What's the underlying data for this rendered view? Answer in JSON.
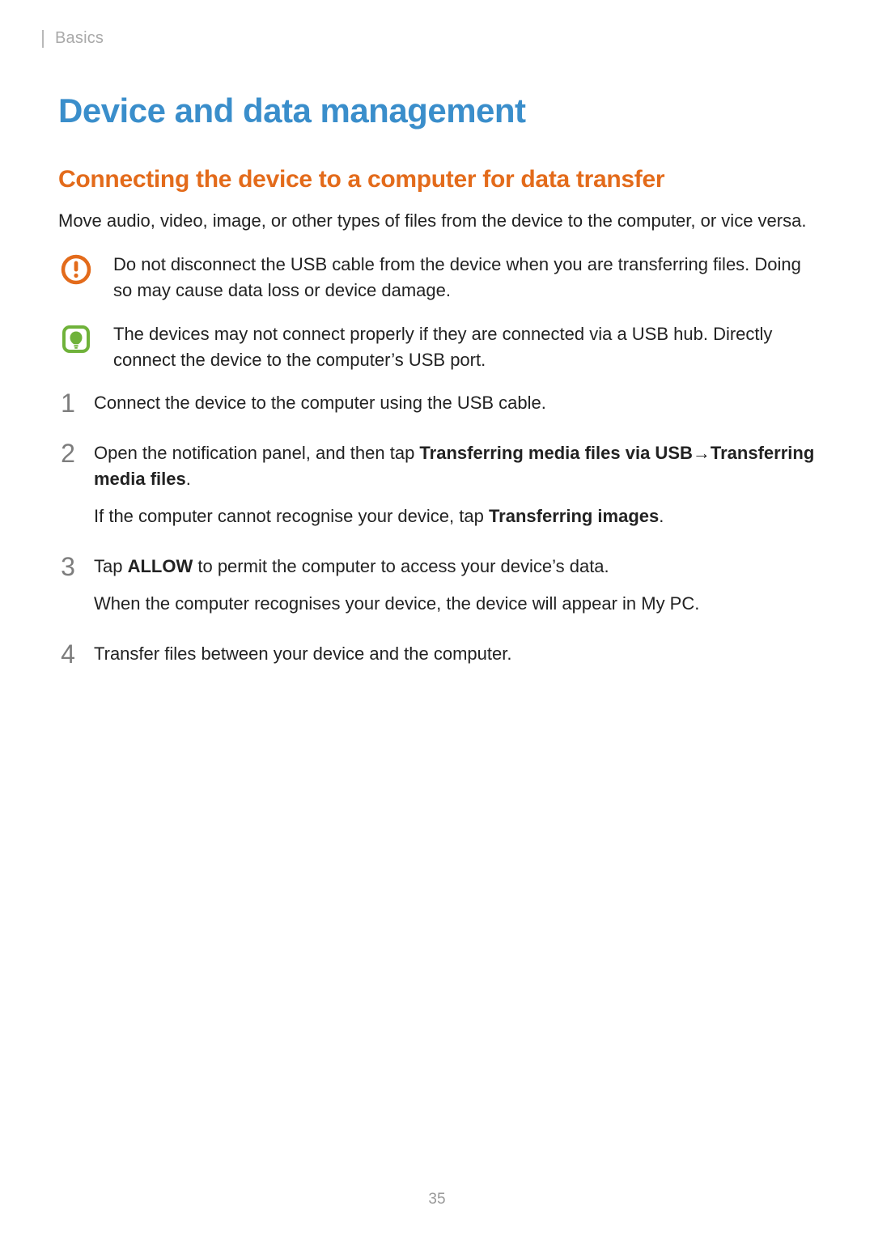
{
  "breadcrumb": "Basics",
  "title": "Device and data management",
  "subtitle": "Connecting the device to a computer for data transfer",
  "intro": "Move audio, video, image, or other types of files from the device to the computer, or vice versa.",
  "callouts": {
    "warning": {
      "text": "Do not disconnect the USB cable from the device when you are transferring files. Doing so may cause data loss or device damage.",
      "icon_name": "warning-icon",
      "color": "#e36b1b"
    },
    "note": {
      "text": "The devices may not connect properly if they are connected via a USB hub. Directly connect the device to the computer’s USB port.",
      "icon_name": "note-icon",
      "color": "#6fb23a"
    }
  },
  "steps": [
    {
      "num": "1",
      "lines": [
        {
          "prefix": "Connect the device to the computer using the USB cable."
        }
      ]
    },
    {
      "num": "2",
      "lines": [
        {
          "prefix": "Open the notification panel, and then tap ",
          "bold1": "Transferring media files via USB",
          "arrow": " → ",
          "bold2": "Transferring media files",
          "suffix": "."
        },
        {
          "prefix": "If the computer cannot recognise your device, tap ",
          "bold1": "Transferring images",
          "suffix": "."
        }
      ]
    },
    {
      "num": "3",
      "lines": [
        {
          "prefix": "Tap ",
          "bold1": "ALLOW",
          "suffix": " to permit the computer to access your device’s data."
        },
        {
          "prefix": "When the computer recognises your device, the device will appear in My PC."
        }
      ]
    },
    {
      "num": "4",
      "lines": [
        {
          "prefix": "Transfer files between your device and the computer."
        }
      ]
    }
  ],
  "page_number": "35"
}
